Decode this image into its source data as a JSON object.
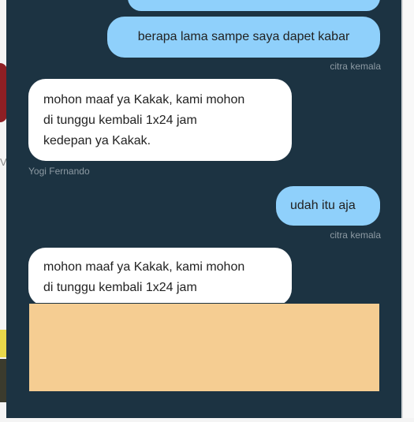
{
  "messages": [
    {
      "direction": "outgoing",
      "text": "berapa lama sampe saya dapet kabar",
      "sender": "citra kemala"
    },
    {
      "direction": "incoming",
      "lines": [
        "mohon maaf ya Kakak, kami mohon",
        "di tunggu kembali 1x24 jam",
        "kedepan ya Kakak."
      ],
      "sender": "Yogi Fernando"
    },
    {
      "direction": "outgoing",
      "text": "udah itu aja",
      "sender": "citra kemala"
    },
    {
      "direction": "incoming",
      "lines": [
        "mohon maaf ya Kakak, kami mohon",
        "di tunggu kembali 1x24 jam"
      ]
    }
  ],
  "background": {
    "edge_letter": "V"
  },
  "colors": {
    "panel": "#1c3342",
    "outgoing_bubble": "#8fd0fb",
    "incoming_bubble": "#ffffff",
    "overlay": "#f5cd92"
  }
}
